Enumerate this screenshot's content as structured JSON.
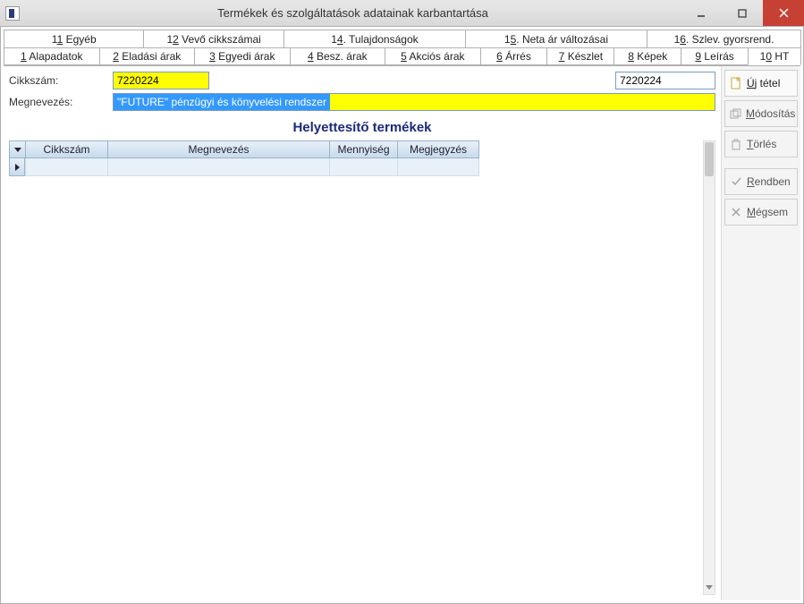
{
  "window": {
    "title": "Termékek és szolgáltatások adatainak karbantartása"
  },
  "tabs_top": [
    {
      "prefix": "1",
      "u": "1",
      "rest": " Egyéb"
    },
    {
      "prefix": "1",
      "u": "2",
      "rest": " Vevő cikkszámai"
    },
    {
      "prefix": "1",
      "u": "4",
      "rest": ". Tulajdonságok"
    },
    {
      "prefix": "1",
      "u": "5",
      "rest": ". Neta ár változásai"
    },
    {
      "prefix": "1",
      "u": "6",
      "rest": ". Szlev. gyorsrend."
    }
  ],
  "tabs_bottom": [
    {
      "u": "1",
      "rest": " Alapadatok",
      "active": false
    },
    {
      "u": "2",
      "rest": " Eladási árak",
      "active": false
    },
    {
      "u": "3",
      "rest": " Egyedi árak",
      "active": false
    },
    {
      "u": "4",
      "rest": " Besz. árak",
      "active": false
    },
    {
      "u": "5",
      "rest": " Akciós árak",
      "active": false
    },
    {
      "u": "6",
      "rest": " Árrés",
      "active": false
    },
    {
      "u": "7",
      "rest": " Készlet",
      "active": false
    },
    {
      "u": "8",
      "rest": " Képek",
      "active": false
    },
    {
      "u": "9",
      "rest": " Leírás",
      "active": false
    },
    {
      "prefix": "1",
      "u": "0",
      "rest": " HT",
      "active": true
    }
  ],
  "form": {
    "cikkszam_label": "Cikkszám:",
    "cikkszam_value": "7220224",
    "cikkszam_right": "7220224",
    "megnevezes_label": "Megnevezés:",
    "megnevezes_value": "\"FUTURE\" pénzügyi és könyvelési rendszer"
  },
  "heading": "Helyettesítő termékek",
  "grid": {
    "headers": {
      "cikkszam": "Cikkszám",
      "megnevezes": "Megnevezés",
      "mennyiseg": "Mennyiség",
      "megjegyzes": "Megjegyzés"
    }
  },
  "buttons": {
    "uj_u": "Ú",
    "uj_rest": "j tétel",
    "modositas_u": "M",
    "modositas_rest": "ódosítás",
    "torles_pre": "",
    "torles_u": "T",
    "torles_rest": "örlés",
    "rendben_u": "R",
    "rendben_rest": "endben",
    "megsem_u": "M",
    "megsem_rest": "égsem"
  }
}
